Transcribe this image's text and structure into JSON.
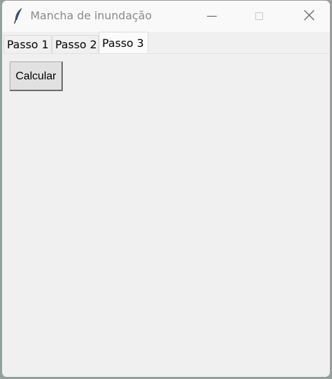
{
  "window": {
    "title": "Mancha de inundação",
    "app_icon": "feather-icon"
  },
  "title_controls": {
    "minimize": "minimize-icon",
    "maximize": "maximize-icon",
    "close": "close-icon"
  },
  "tabs": [
    {
      "label": "Passo 1",
      "selected": false
    },
    {
      "label": "Passo 2",
      "selected": false
    },
    {
      "label": "Passo 3",
      "selected": true
    }
  ],
  "main": {
    "calculate_label": "Calcular"
  },
  "colors": {
    "window_bg": "#f0f0f0",
    "titlebar_bg": "#f9f9f9",
    "title_text": "#8a8a8a"
  }
}
